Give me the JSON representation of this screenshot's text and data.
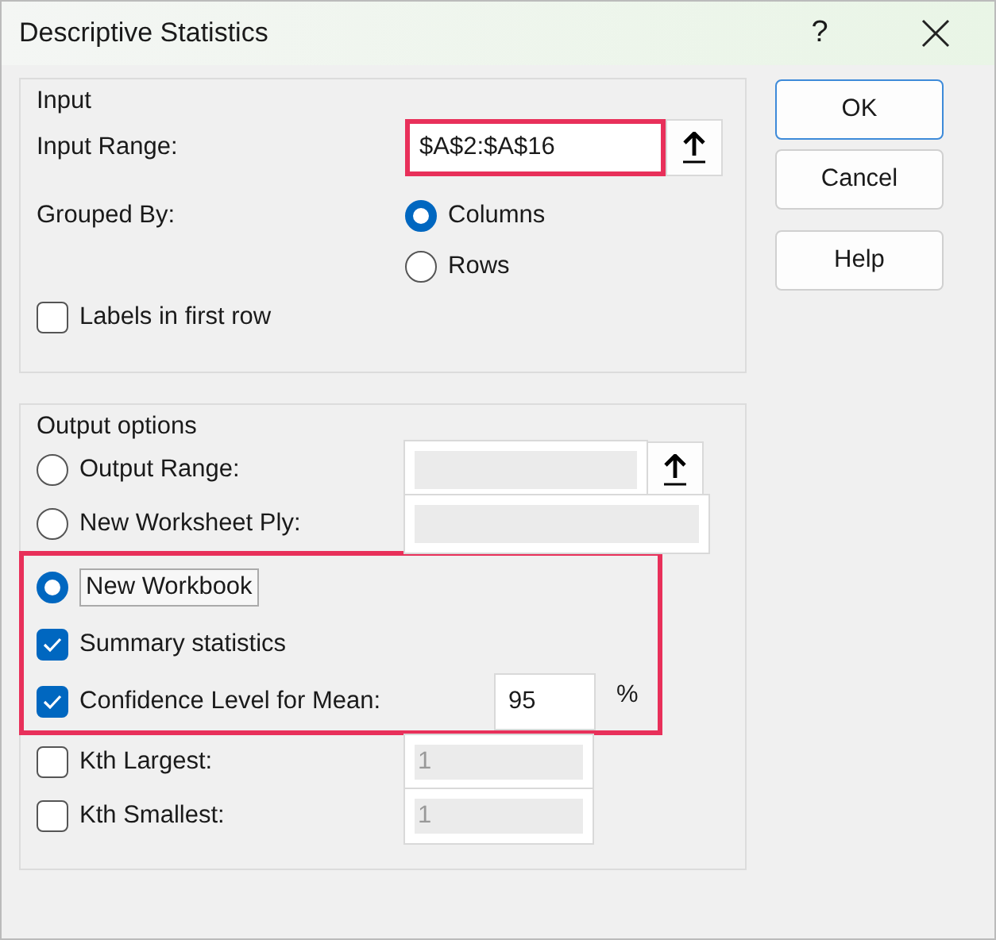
{
  "window": {
    "title": "Descriptive Statistics",
    "help_glyph": "?"
  },
  "input": {
    "title": "Input",
    "range_label": "Input Range:",
    "range_value": "$A$2:$A$16",
    "range_highlighted": true,
    "grouped_by_label": "Grouped By:",
    "grouped_by": [
      {
        "label": "Columns",
        "selected": true
      },
      {
        "label": "Rows",
        "selected": false
      }
    ],
    "labels_checkbox": {
      "label": "Labels in first row",
      "checked": false
    }
  },
  "output": {
    "title": "Output options",
    "rows": [
      {
        "kind": "radio",
        "label": "Output Range:",
        "selected": false,
        "highlighted": false,
        "field": {
          "disabled": true,
          "picker": true
        }
      },
      {
        "kind": "radio",
        "label": "New Worksheet Ply:",
        "selected": false,
        "highlighted": false,
        "field": {
          "disabled": true
        }
      },
      {
        "kind": "radio",
        "label": "New Workbook",
        "selected": true,
        "highlighted": true,
        "focused": true
      },
      {
        "kind": "checkbox",
        "label": "Summary statistics",
        "checked": true,
        "highlighted": true
      },
      {
        "kind": "checkbox",
        "label": "Confidence Level for Mean:",
        "checked": true,
        "highlighted": true,
        "field": {
          "value": "95",
          "disabled": false
        },
        "suffix": "%"
      },
      {
        "kind": "checkbox",
        "label": "Kth Largest:",
        "checked": false,
        "highlighted": false,
        "field": {
          "value": "1",
          "disabled": true
        }
      },
      {
        "kind": "checkbox",
        "label": "Kth Smallest:",
        "checked": false,
        "highlighted": false,
        "field": {
          "value": "1",
          "disabled": true
        }
      }
    ]
  },
  "buttons": [
    {
      "label": "OK",
      "default": true
    },
    {
      "label": "Cancel",
      "default": false
    },
    {
      "label": "Help",
      "default": false
    }
  ]
}
